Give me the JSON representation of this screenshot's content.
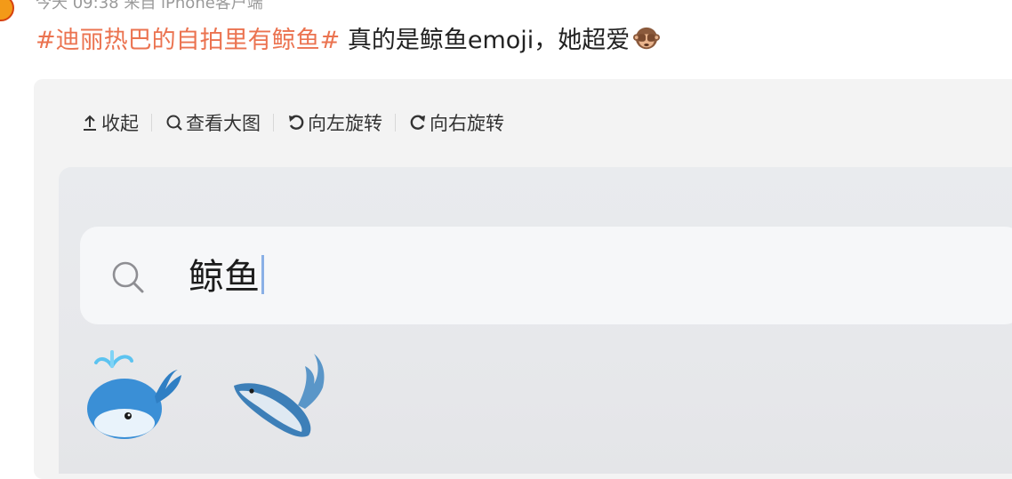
{
  "post": {
    "meta_text": "今天 09:38 来自 iPhone客户端",
    "hashtag": "#迪丽热巴的自拍里有鲸鱼#",
    "body_text": " 真的是鲸鱼emoji，她超爱",
    "inline_emoji": "see-no-evil-monkey-icon"
  },
  "toolbar": {
    "collapse_label": "收起",
    "view_large_label": "查看大图",
    "rotate_left_label": "向左旋转",
    "rotate_right_label": "向右旋转"
  },
  "search": {
    "query": "鲸鱼"
  },
  "results": [
    {
      "name": "spouting-whale-icon"
    },
    {
      "name": "whale-icon"
    }
  ],
  "colors": {
    "hashtag": "#eb7350",
    "card_bg": "#f3f3f3",
    "search_bg": "#f6f7f9",
    "caret": "#8ab0e6"
  }
}
